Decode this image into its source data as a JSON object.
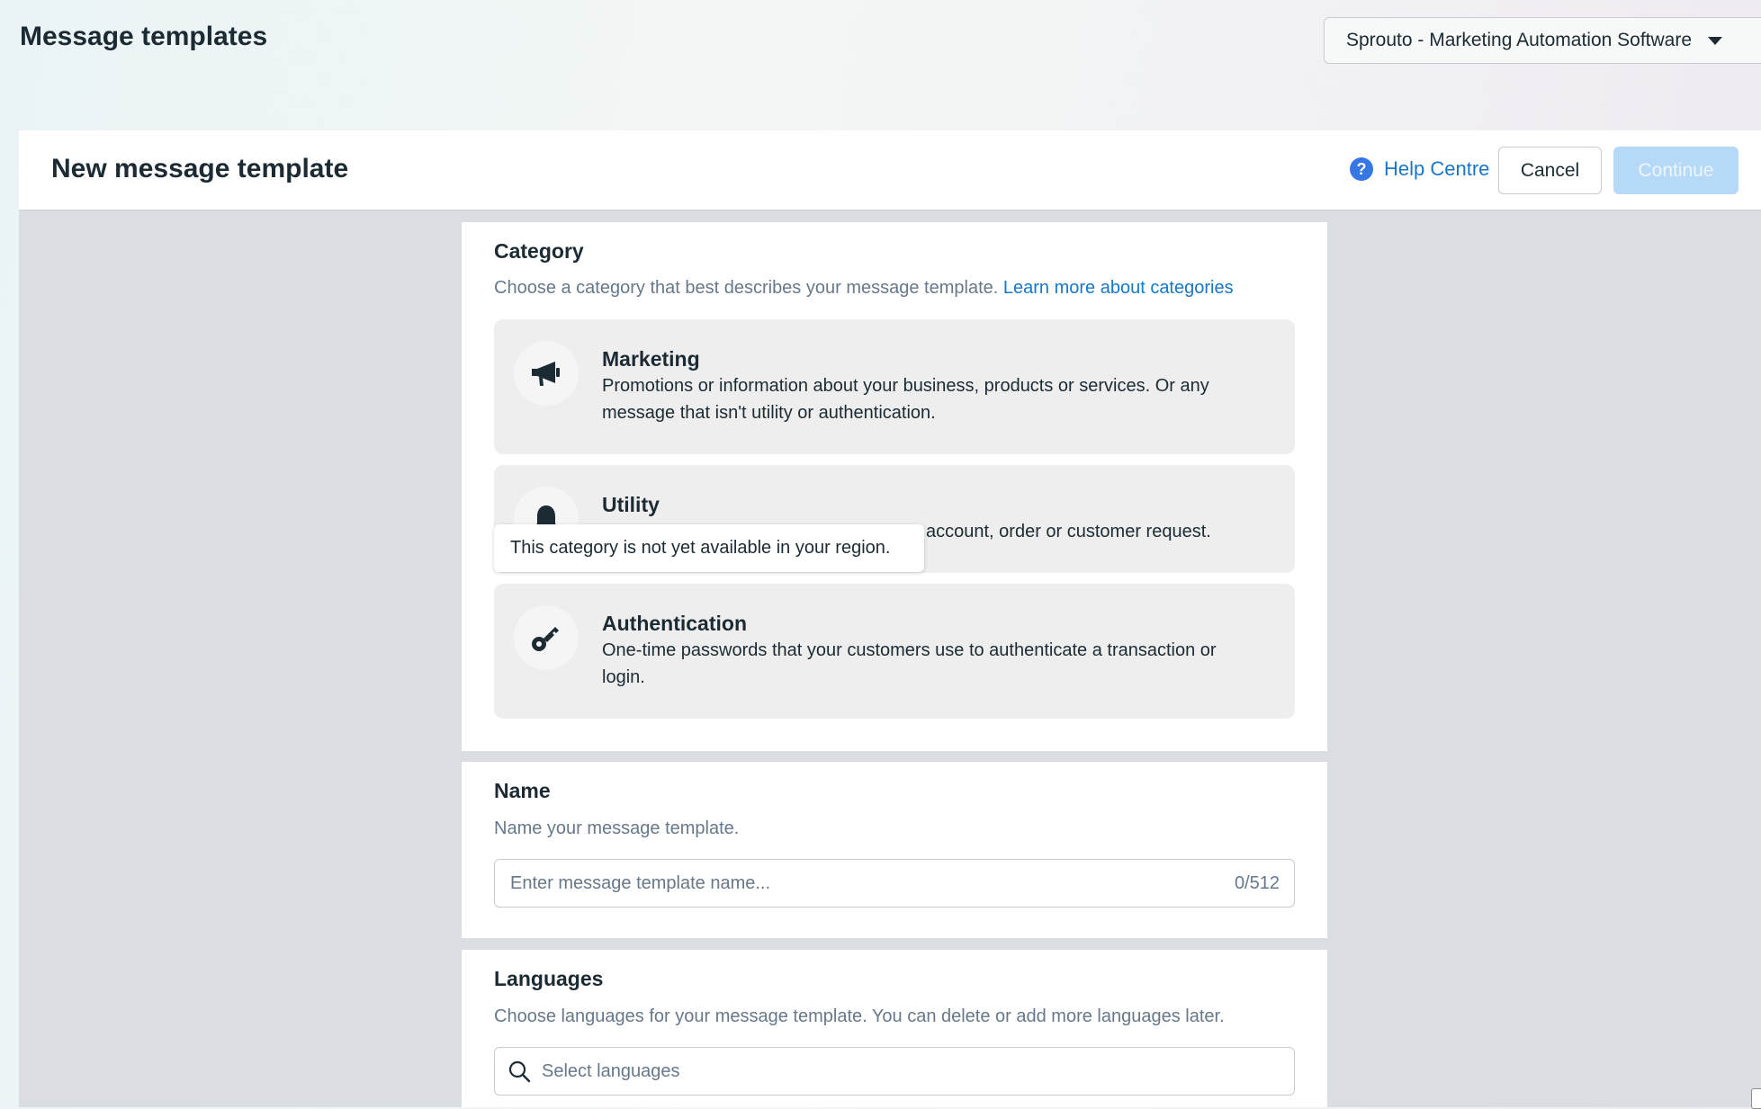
{
  "page": {
    "title": "Message templates",
    "account_selector": "Sprouto - Marketing Automation Software"
  },
  "builder": {
    "title": "New message template",
    "help_label": "Help Centre",
    "cancel_label": "Cancel",
    "continue_label": "Continue"
  },
  "category": {
    "heading": "Category",
    "description": "Choose a category that best describes your message template.",
    "learn_more": "Learn more about categories",
    "options": [
      {
        "title": "Marketing",
        "description": "Promotions or information about your business, products or services. Or any message that isn't utility or authentication.",
        "icon": "megaphone-icon"
      },
      {
        "title": "Utility",
        "description": "account, order or customer request.",
        "icon": "bell-icon"
      },
      {
        "title": "Authentication",
        "description": "One-time passwords that your customers use to authenticate a transaction or login.",
        "icon": "key-icon"
      }
    ],
    "tooltip": "This category is not yet available in your region."
  },
  "name": {
    "heading": "Name",
    "description": "Name your message template.",
    "placeholder": "Enter message template name...",
    "counter": "0/512"
  },
  "languages": {
    "heading": "Languages",
    "description": "Choose languages for your message template. You can delete or add more languages later.",
    "placeholder": "Select languages"
  },
  "colors": {
    "link": "#1877c9",
    "primary_disabled": "#b5d9f6",
    "help_icon": "#3578e5"
  }
}
